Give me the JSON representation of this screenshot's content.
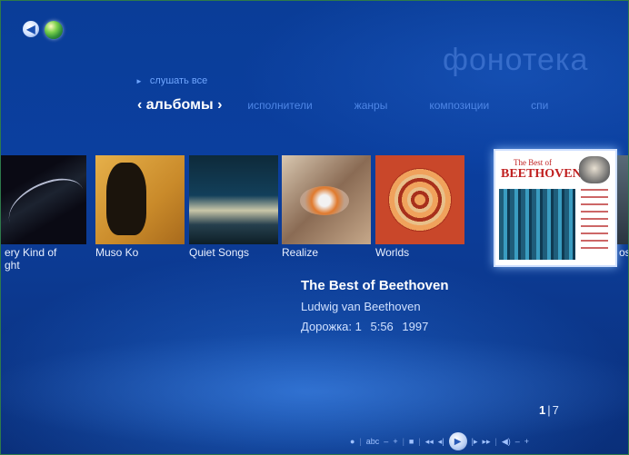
{
  "header": {
    "title": "фонотека",
    "play_all": "слушать все",
    "tabs": [
      {
        "label": "‹ альбомы ›",
        "active": true
      },
      {
        "label": "исполнители"
      },
      {
        "label": "жанры"
      },
      {
        "label": "композиции"
      },
      {
        "label": "спи"
      }
    ]
  },
  "albums": [
    {
      "caption_line1": "ery Kind of",
      "caption_line2": "ght"
    },
    {
      "caption": "Muso Ko"
    },
    {
      "caption": "Quiet Songs"
    },
    {
      "caption": "Realize"
    },
    {
      "caption": "Worlds"
    },
    {
      "selected_cover_line1": "The Best of",
      "selected_cover_line2": "BEETHOVEN"
    },
    {
      "caption": "os"
    }
  ],
  "selected": {
    "album": "The Best of Beethoven",
    "artist": "Ludwig van Beethoven",
    "track_label": "Дорожка: 1",
    "duration": "5:56",
    "year": "1997"
  },
  "pager": {
    "current": "1",
    "total": "7"
  },
  "transport": {
    "buttons": [
      "●",
      "|",
      "abc",
      "–",
      "+",
      "|",
      "■",
      "|",
      "◂◂",
      "◂|",
      "▶",
      "|▸",
      "▸▸",
      "|",
      "◀)",
      "–",
      "+"
    ]
  },
  "colors": {
    "background": "#0b3f9f",
    "accent": "#4e86e6",
    "text": "#ffffff"
  }
}
